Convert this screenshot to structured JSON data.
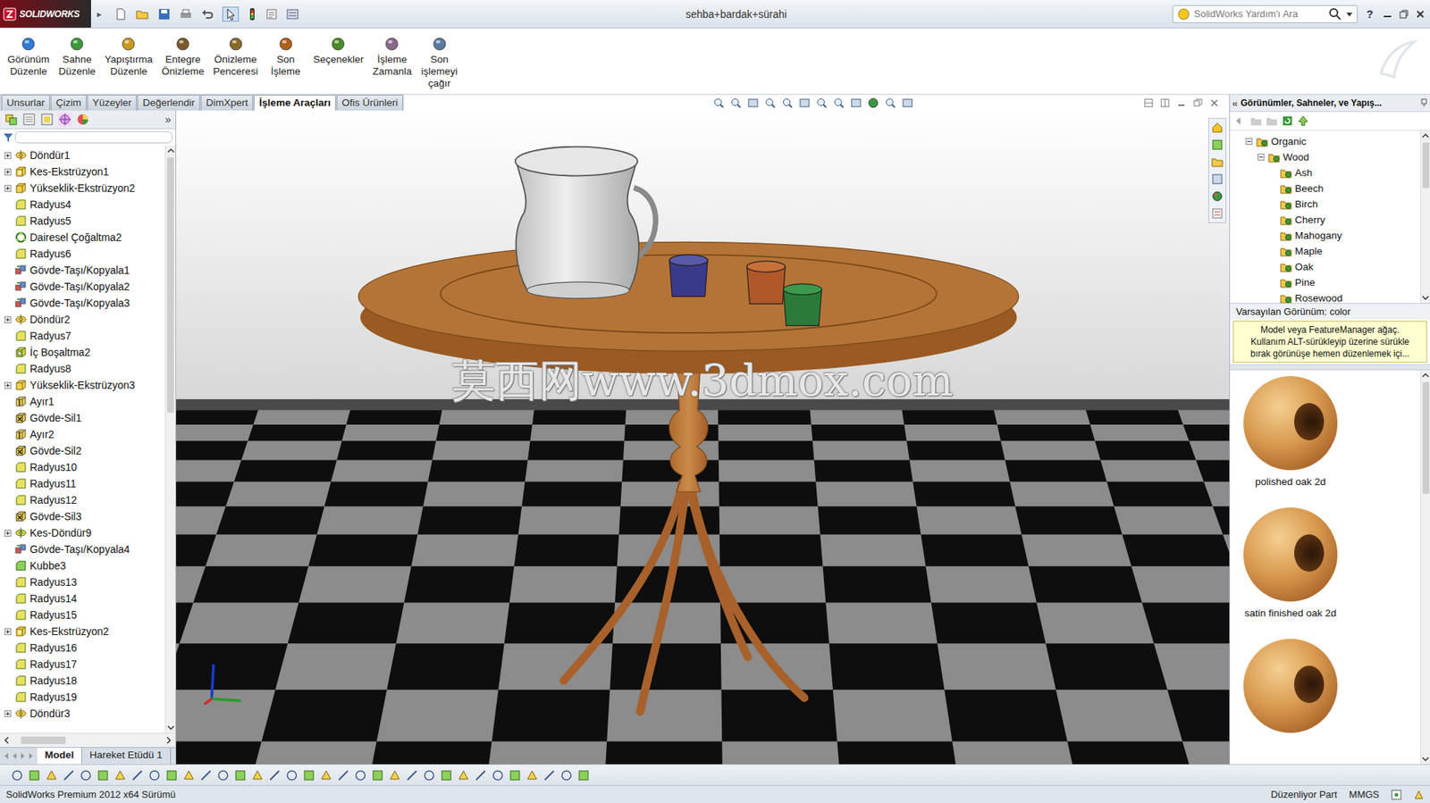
{
  "window": {
    "app_name": "SOLIDWORKS",
    "menu_arrow": "▸",
    "title": "sehba+bardak+sürahi",
    "search_placeholder": "SolidWorks Yardım'ı Ara",
    "help": "?"
  },
  "ribbon": [
    {
      "lines": [
        "Görünüm",
        "Düzenle"
      ]
    },
    {
      "lines": [
        "Sahne",
        "Düzenle"
      ]
    },
    {
      "lines": [
        "Yapıştırma",
        "Düzenle"
      ]
    },
    {
      "lines": [
        "Entegre",
        "Önizleme"
      ]
    },
    {
      "lines": [
        "Önizleme",
        "Penceresi"
      ]
    },
    {
      "lines": [
        "Son",
        "İşleme"
      ]
    },
    {
      "lines": [
        "Seçenekler"
      ]
    },
    {
      "lines": [
        "İşleme",
        "Zamanla"
      ]
    },
    {
      "lines": [
        "Son",
        "işlemeyi",
        "çağır"
      ]
    }
  ],
  "tabs": [
    {
      "label": "Unsurlar",
      "selected": false
    },
    {
      "label": "Çizim",
      "selected": false
    },
    {
      "label": "Yüzeyler",
      "selected": false
    },
    {
      "label": "Değerlendir",
      "selected": false
    },
    {
      "label": "DimXpert",
      "selected": false
    },
    {
      "label": "İşleme Araçları",
      "selected": true
    },
    {
      "label": "Ofis Ürünleri",
      "selected": false
    }
  ],
  "feature_tree": {
    "more": "»",
    "items": [
      {
        "label": "Döndür1",
        "kind": "revolve",
        "expandable": true,
        "expanded": false
      },
      {
        "label": "Kes-Ekstrüzyon1",
        "kind": "cut-extrude",
        "expandable": true,
        "expanded": false
      },
      {
        "label": "Yükseklik-Ekstrüzyon2",
        "kind": "extrude",
        "expandable": true,
        "expanded": false
      },
      {
        "label": "Radyus4",
        "kind": "fillet",
        "expandable": false,
        "expanded": false
      },
      {
        "label": "Radyus5",
        "kind": "fillet",
        "expandable": false,
        "expanded": false
      },
      {
        "label": "Dairesel Çoğaltma2",
        "kind": "pattern",
        "expandable": false,
        "expanded": false
      },
      {
        "label": "Radyus6",
        "kind": "fillet",
        "expandable": false,
        "expanded": false
      },
      {
        "label": "Gövde-Taşı/Kopyala1",
        "kind": "move-copy",
        "expandable": false,
        "expanded": false
      },
      {
        "label": "Gövde-Taşı/Kopyala2",
        "kind": "move-copy",
        "expandable": false,
        "expanded": false
      },
      {
        "label": "Gövde-Taşı/Kopyala3",
        "kind": "move-copy",
        "expandable": false,
        "expanded": false
      },
      {
        "label": "Döndür2",
        "kind": "revolve",
        "expandable": true,
        "expanded": false
      },
      {
        "label": "Radyus7",
        "kind": "fillet",
        "expandable": false,
        "expanded": false
      },
      {
        "label": "İç Boşaltma2",
        "kind": "shell",
        "expandable": false,
        "expanded": false
      },
      {
        "label": "Radyus8",
        "kind": "fillet",
        "expandable": false,
        "expanded": false
      },
      {
        "label": "Yükseklik-Ekstrüzyon3",
        "kind": "extrude",
        "expandable": true,
        "expanded": false
      },
      {
        "label": "Ayır1",
        "kind": "split",
        "expandable": false,
        "expanded": false
      },
      {
        "label": "Gövde-Sil1",
        "kind": "delete-body",
        "expandable": false,
        "expanded": false
      },
      {
        "label": "Ayır2",
        "kind": "split",
        "expandable": false,
        "expanded": false
      },
      {
        "label": "Gövde-Sil2",
        "kind": "delete-body",
        "expandable": false,
        "expanded": false
      },
      {
        "label": "Radyus10",
        "kind": "fillet",
        "expandable": false,
        "expanded": false
      },
      {
        "label": "Radyus11",
        "kind": "fillet",
        "expandable": false,
        "expanded": false
      },
      {
        "label": "Radyus12",
        "kind": "fillet",
        "expandable": false,
        "expanded": false
      },
      {
        "label": "Gövde-Sil3",
        "kind": "delete-body",
        "expandable": false,
        "expanded": false
      },
      {
        "label": "Kes-Döndür9",
        "kind": "cut-revolve",
        "expandable": true,
        "expanded": false
      },
      {
        "label": "Gövde-Taşı/Kopyala4",
        "kind": "move-copy",
        "expandable": false,
        "expanded": false
      },
      {
        "label": "Kubbe3",
        "kind": "dome",
        "expandable": false,
        "expanded": false
      },
      {
        "label": "Radyus13",
        "kind": "fillet",
        "expandable": false,
        "expanded": false
      },
      {
        "label": "Radyus14",
        "kind": "fillet",
        "expandable": false,
        "expanded": false
      },
      {
        "label": "Radyus15",
        "kind": "fillet",
        "expandable": false,
        "expanded": false
      },
      {
        "label": "Kes-Ekstrüzyon2",
        "kind": "cut-extrude",
        "expandable": true,
        "expanded": false
      },
      {
        "label": "Radyus16",
        "kind": "fillet",
        "expandable": false,
        "expanded": false
      },
      {
        "label": "Radyus17",
        "kind": "fillet",
        "expandable": false,
        "expanded": false
      },
      {
        "label": "Radyus18",
        "kind": "fillet",
        "expandable": false,
        "expanded": false
      },
      {
        "label": "Radyus19",
        "kind": "fillet",
        "expandable": false,
        "expanded": false
      },
      {
        "label": "Döndür3",
        "kind": "revolve",
        "expandable": true,
        "expanded": false
      }
    ]
  },
  "bottom_tabs": [
    {
      "label": "Model",
      "selected": true
    },
    {
      "label": "Hareket Etüdü 1",
      "selected": false
    }
  ],
  "viewport": {
    "watermark": "莫西网www.3dmox.com"
  },
  "task_pane": {
    "collapse": "«",
    "title": "Görünümler, Sahneler, ve Yapış...",
    "tree": [
      {
        "label": "Organic",
        "expanded": true,
        "children": [
          {
            "label": "Wood",
            "expanded": true,
            "children": [
              {
                "label": "Ash"
              },
              {
                "label": "Beech"
              },
              {
                "label": "Birch"
              },
              {
                "label": "Cherry"
              },
              {
                "label": "Mahogany"
              },
              {
                "label": "Maple"
              },
              {
                "label": "Oak"
              },
              {
                "label": "Pine"
              },
              {
                "label": "Rosewood"
              }
            ]
          }
        ]
      }
    ],
    "default_appearance": "Varsayılan Görünüm: color",
    "tip_lines": [
      "Model veya FeatureManager ağaç.",
      "Kullanım ALT-sürükleyip üzerine sürükle",
      "bırak görünüşe hemen düzenlemek içi..."
    ],
    "swatches": [
      {
        "label": "polished oak 2d"
      },
      {
        "label": "satin finished oak 2d"
      },
      {
        "label": ""
      }
    ]
  },
  "status_bar": {
    "text": "SolidWorks Premium 2012 x64 Sürümü",
    "mode": "Düzenliyor Part",
    "units": "MMGS"
  }
}
